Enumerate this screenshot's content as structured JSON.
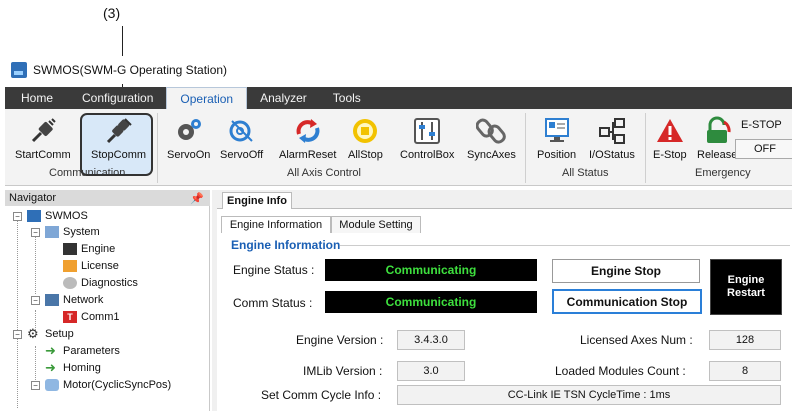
{
  "callout": "(3)",
  "window_title": "SWMOS(SWM-G Operating Station)",
  "menu_tabs": [
    "Home",
    "Configuration",
    "Operation",
    "Analyzer",
    "Tools"
  ],
  "ribbon": {
    "buttons": {
      "start_comm": "StartComm",
      "stop_comm": "StopComm",
      "servo_on": "ServoOn",
      "servo_off": "ServoOff",
      "alarm_reset": "AlarmReset",
      "all_stop": "AllStop",
      "control_box": "ControlBox",
      "sync_axes": "SyncAxes",
      "position": "Position",
      "io_status": "I/OStatus",
      "e_stop": "E-Stop",
      "release": "Release"
    },
    "groups": {
      "communication": "Communication",
      "all_axis_control": "All Axis Control",
      "all_status": "All Status",
      "emergency": "Emergency"
    },
    "estop_label": "E-STOP",
    "estop_state": "OFF"
  },
  "navigator": {
    "title": "Navigator",
    "pin": "ᵖ",
    "items": {
      "root": "SWMOS",
      "system": "System",
      "engine": "Engine",
      "license": "License",
      "diagnostics": "Diagnostics",
      "network": "Network",
      "comm1": "Comm1",
      "setup": "Setup",
      "parameters": "Parameters",
      "homing": "Homing",
      "motor": "Motor(CyclicSyncPos)"
    }
  },
  "engine_info": {
    "doc_tab": "Engine Info",
    "sub_tabs": [
      "Engine Information",
      "Module Setting"
    ],
    "group_title": "Engine Information",
    "engine_status_label": "Engine Status :",
    "engine_status_value": "Communicating",
    "comm_status_label": "Comm Status :",
    "comm_status_value": "Communicating",
    "engine_stop_button": "Engine Stop",
    "communication_stop_button": "Communication Stop",
    "engine_restart_button": [
      "Engine",
      "Restart"
    ],
    "engine_version_label": "Engine Version :",
    "engine_version_value": "3.4.3.0",
    "imlib_version_label": "IMLib Version :",
    "imlib_version_value": "3.0",
    "licensed_axes_label": "Licensed Axes Num :",
    "licensed_axes_value": "128",
    "loaded_modules_label": "Loaded Modules Count :",
    "loaded_modules_value": "8",
    "comm_cycle_label": "Set Comm Cycle Info :",
    "comm_cycle_value": "CC-Link IE TSN CycleTime : 1ms"
  }
}
